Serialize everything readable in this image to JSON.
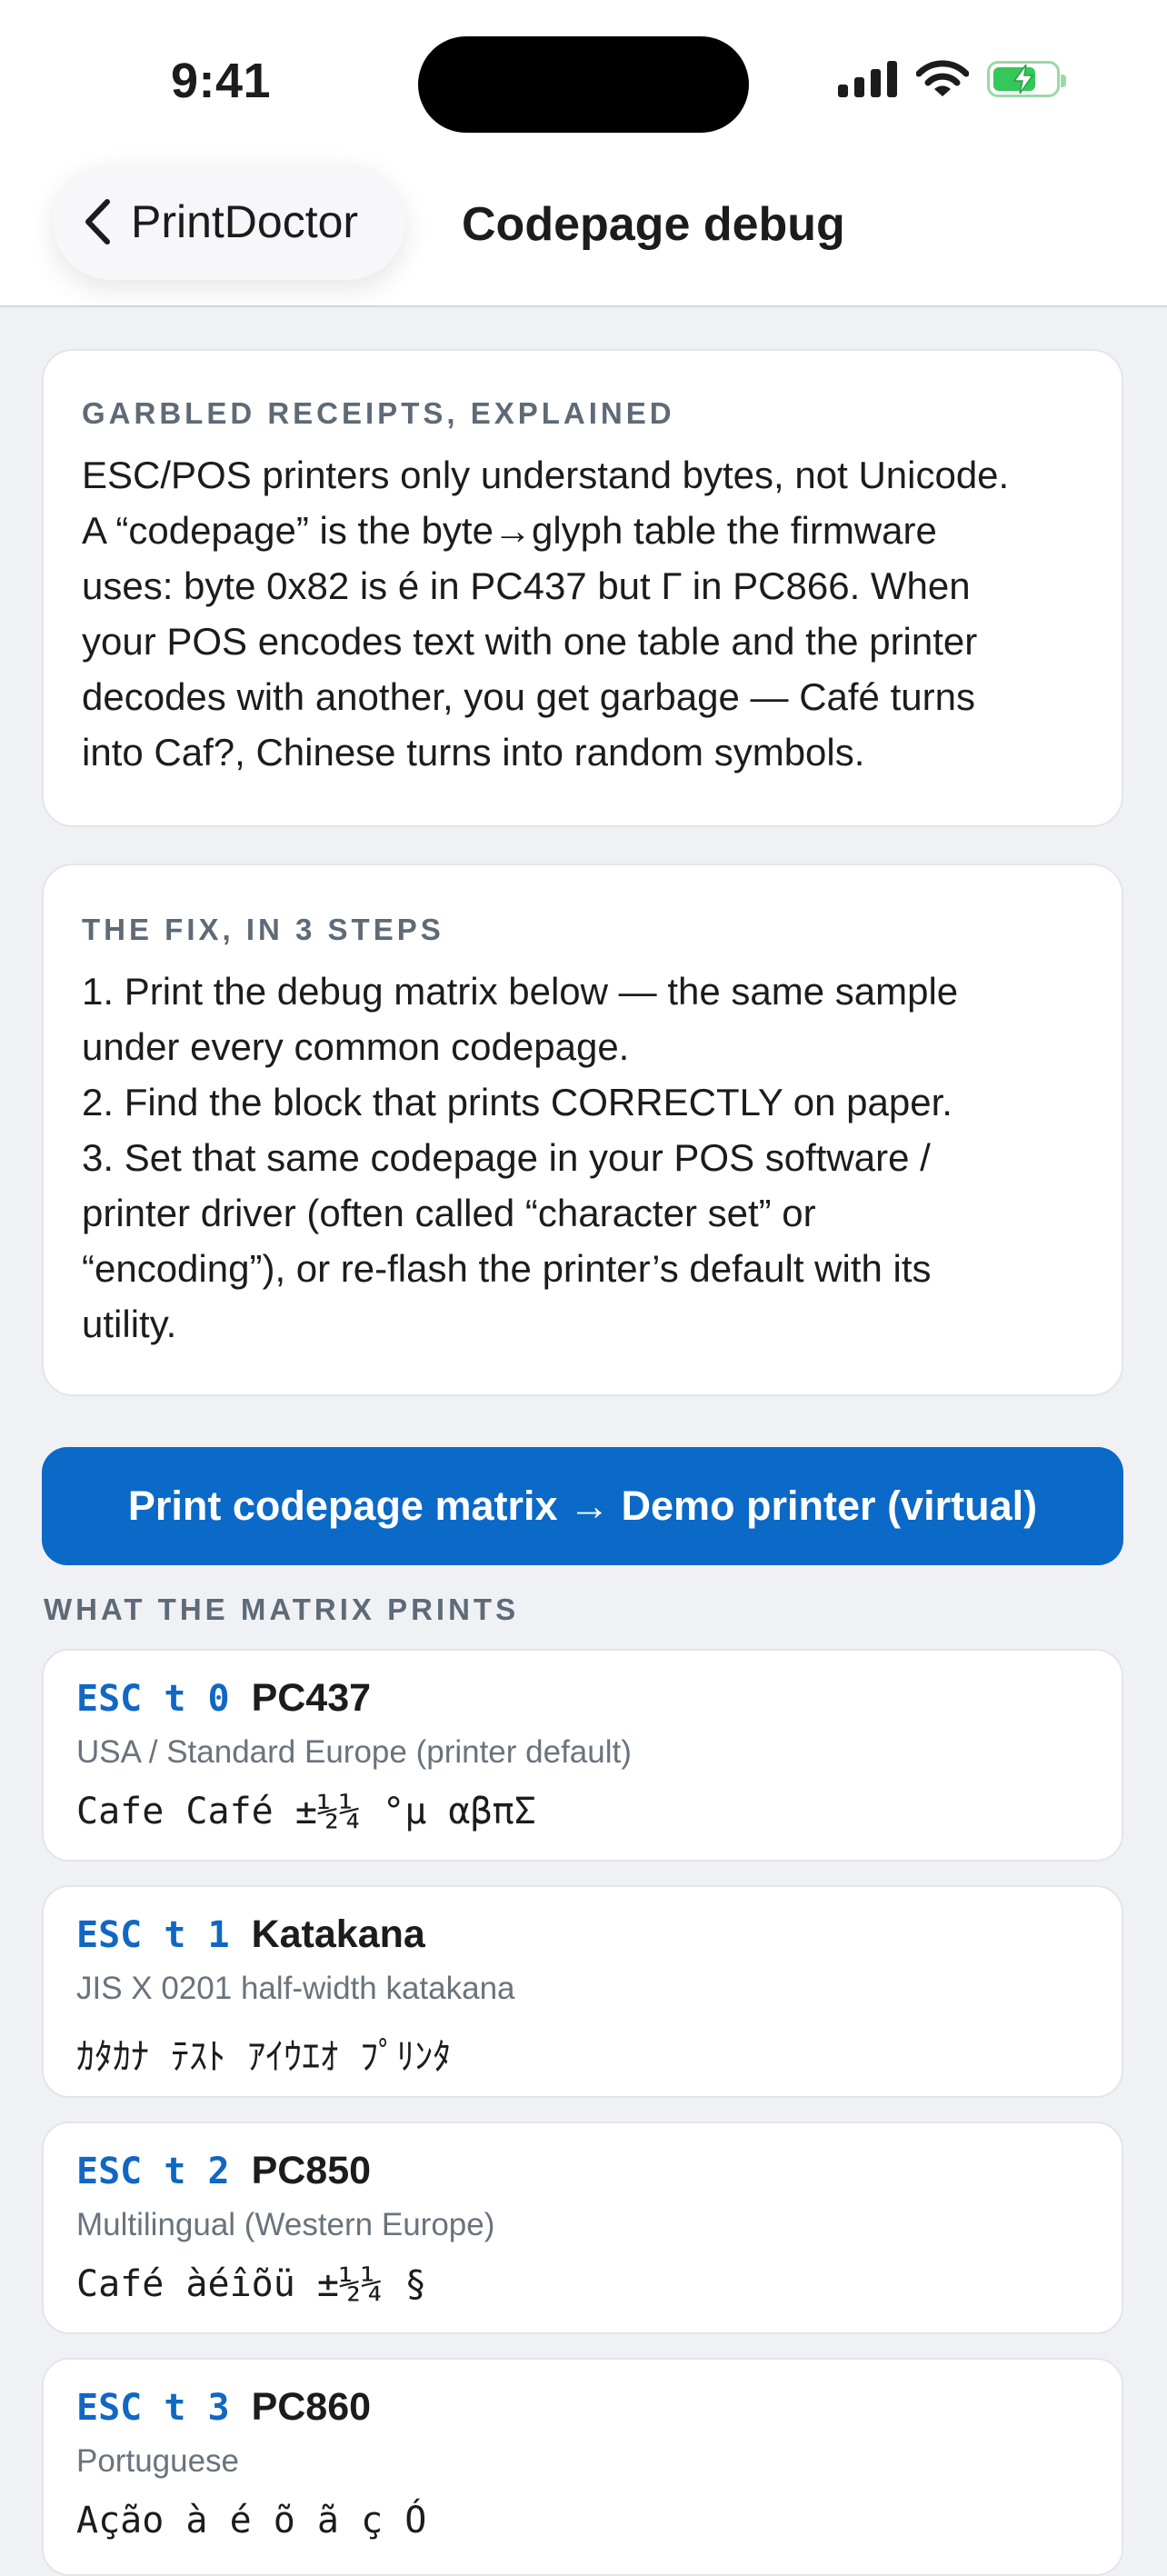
{
  "status_bar": {
    "time": "9:41",
    "icons": [
      "cellular-signal-icon",
      "wifi-icon",
      "battery-charging-icon"
    ],
    "battery_level": 0.7
  },
  "nav": {
    "back_label": "PrintDoctor",
    "title": "Codepage debug"
  },
  "explain_card": {
    "heading": "GARBLED RECEIPTS, EXPLAINED",
    "lines": [
      "ESC/POS printers only understand bytes, not Unicode.",
      "A “codepage” is the byte→glyph table the firmware",
      "uses: byte 0x82 is é in PC437 but Г in PC866. When",
      "your POS encodes text with one table and the printer",
      "decodes with another, you get garbage — Café turns",
      "into Caf?, Chinese turns into random symbols."
    ]
  },
  "fix_card": {
    "heading": "THE FIX, IN 3 STEPS",
    "lines": [
      "1. Print the debug matrix below — the same sample",
      "under every common codepage.",
      "2. Find the block that prints CORRECTLY on paper.",
      "3. Set that same codepage in your POS software /",
      "printer driver (often called “character set” or",
      "“encoding”), or re-flash the printer’s default with its",
      "utility."
    ]
  },
  "print_button_label": "Print codepage matrix → Demo printer (virtual)",
  "matrix_heading": "WHAT THE MATRIX PRINTS",
  "codepages": [
    {
      "command": "ESC t 0",
      "name": "PC437",
      "description": "USA / Standard Europe (printer default)",
      "sample": "Cafe Café ±½¼ °µ αβπΣ"
    },
    {
      "command": "ESC t 1",
      "name": "Katakana",
      "description": "JIS X 0201 half-width katakana",
      "sample": "ｶﾀｶﾅ ﾃｽﾄ ｱｲｳｴｵ ﾌﾟﾘﾝﾀ"
    },
    {
      "command": "ESC t 2",
      "name": "PC850",
      "description": "Multilingual (Western Europe)",
      "sample": "Café àéîõü ±½¼ §"
    },
    {
      "command": "ESC t 3",
      "name": "PC860",
      "description": "Portuguese",
      "sample": "Ação à é õ ã ç Ó"
    }
  ]
}
